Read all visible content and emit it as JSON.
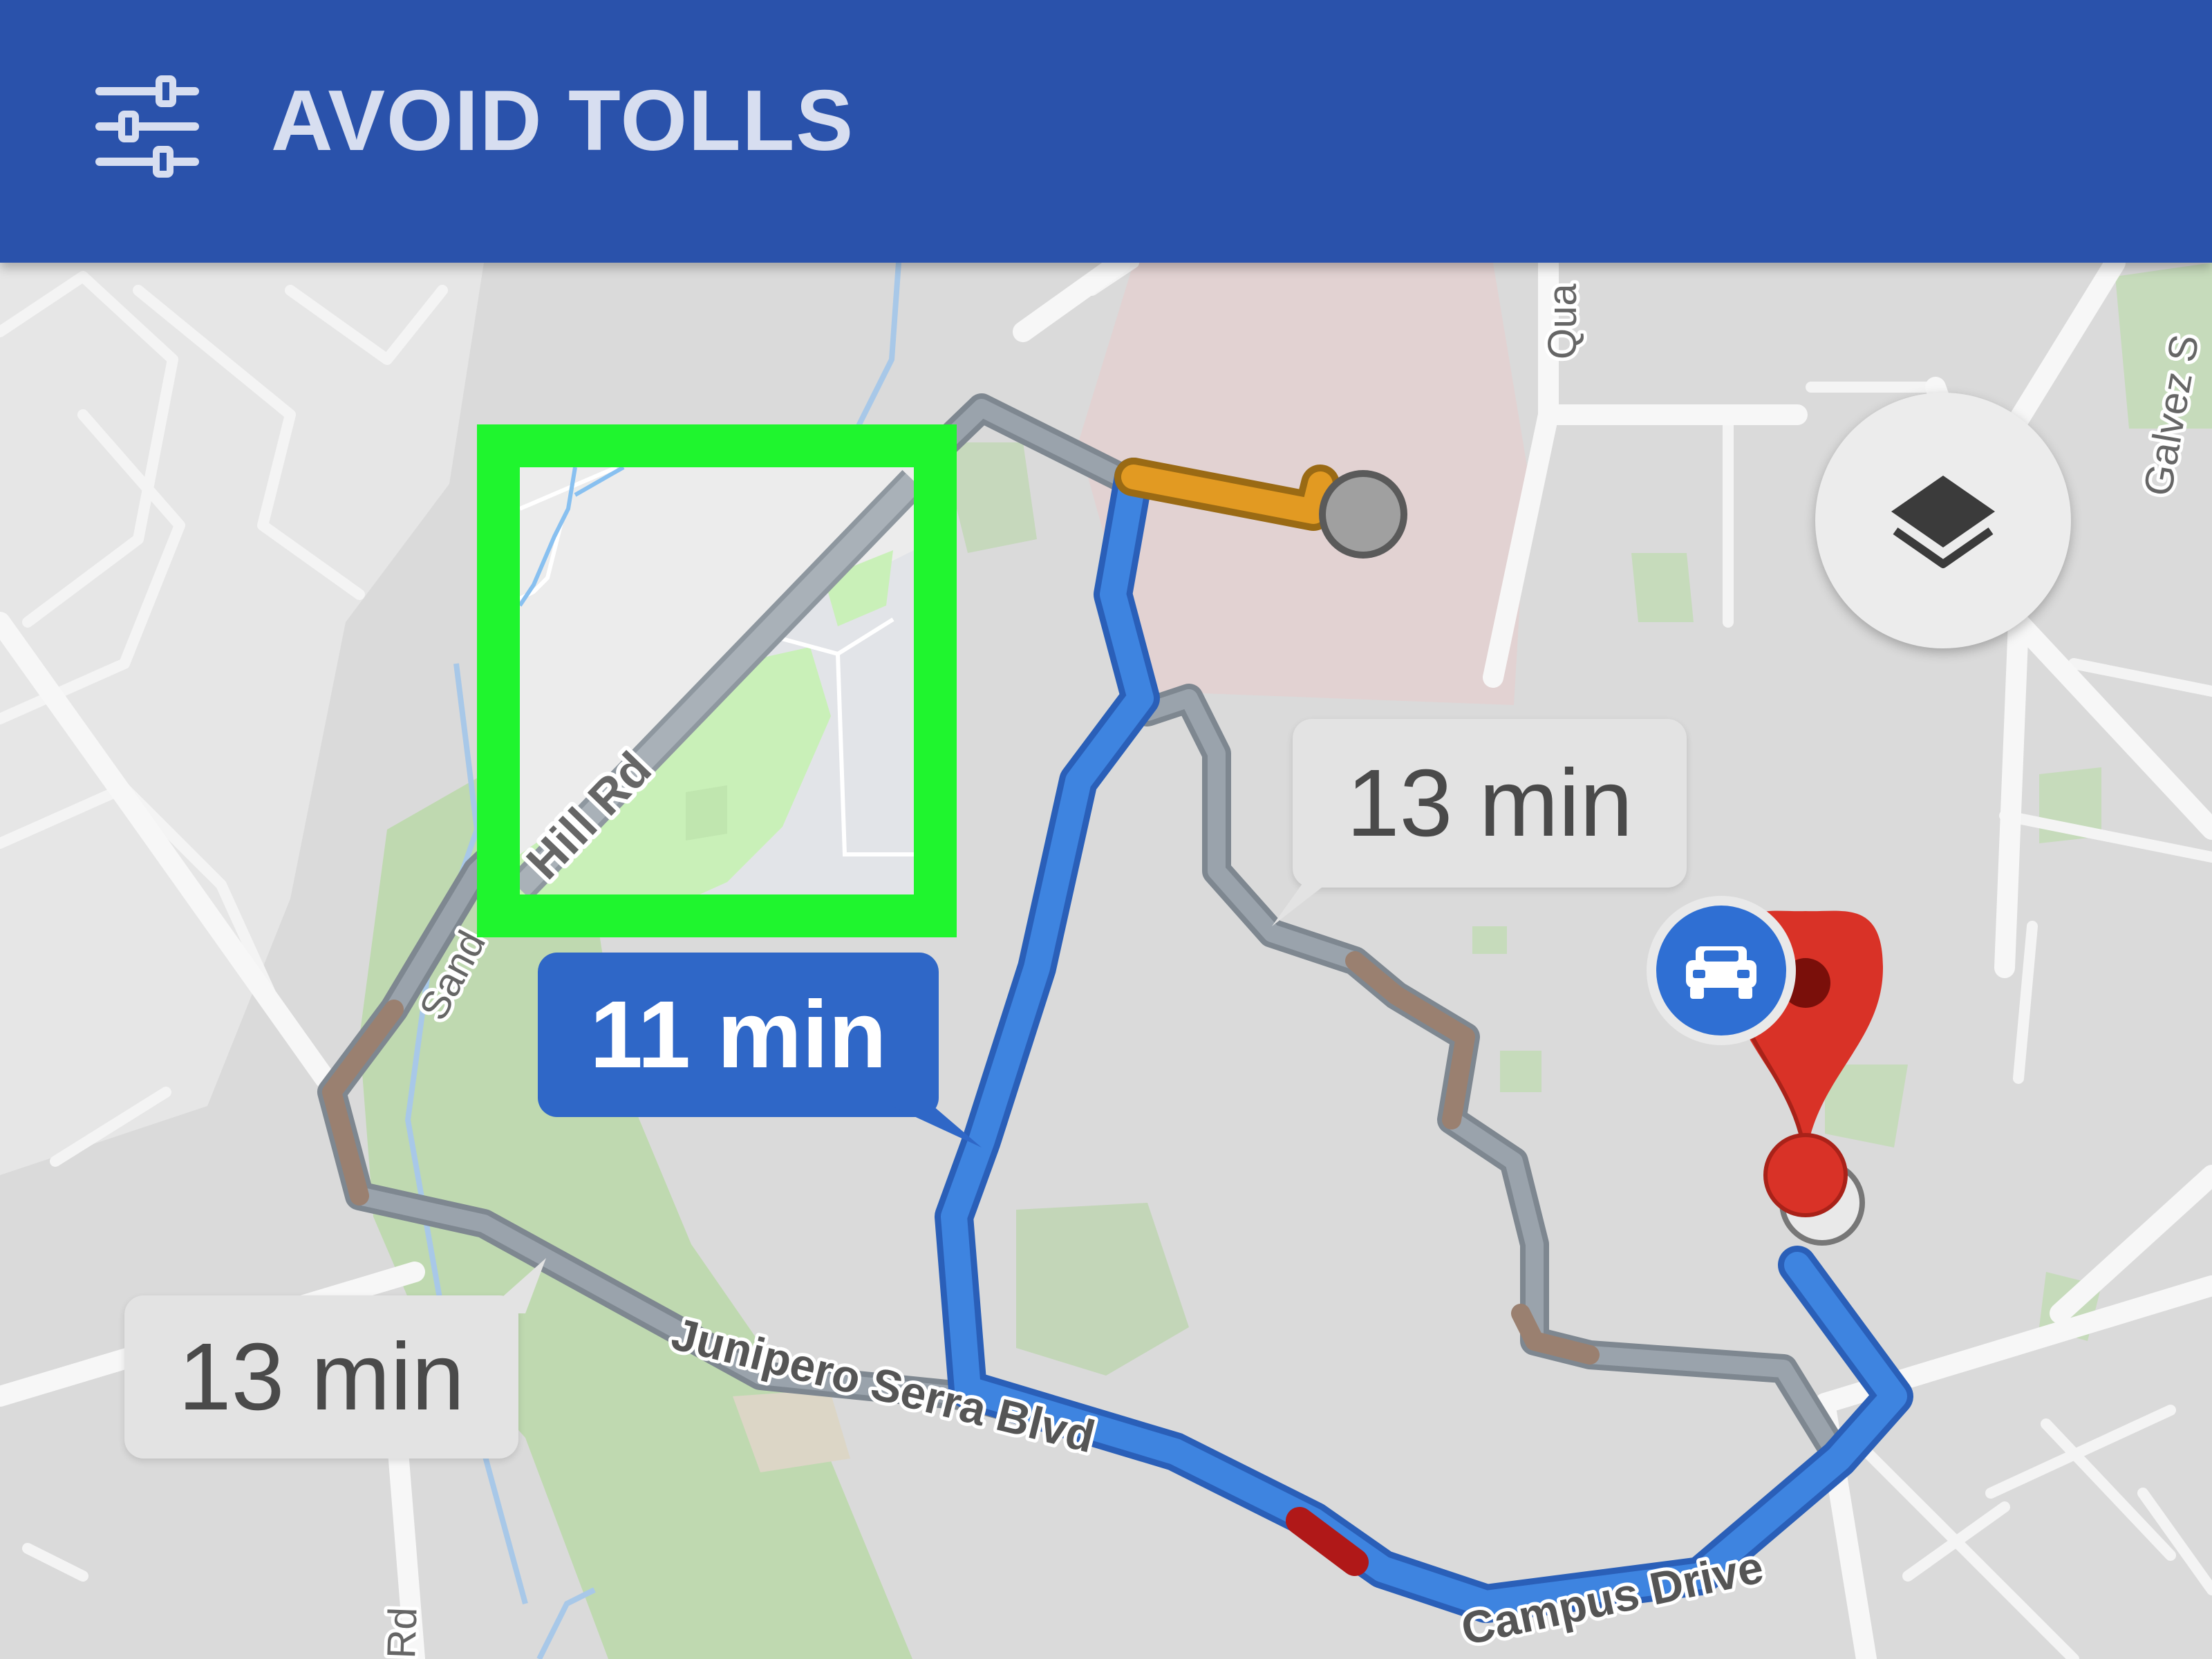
{
  "topbar": {
    "title": "AVOID TOLLS",
    "icon": "tune-sliders-icon",
    "background": "#2a52ab"
  },
  "map": {
    "street_labels": {
      "sand_hill": "Sand",
      "junipero_serra": "Junipero Serra Blvd",
      "campus_drive": "Campus Drive",
      "quarry": "Qua",
      "galvez": "Galvez S",
      "rd_bottom": "Rd"
    },
    "zoom_inset_label": "Hill Rd",
    "layers_icon": "layers-icon",
    "car_icon": "car-icon",
    "destination_icon": "destination-pin-icon",
    "origin_icon": "origin-dot-icon"
  },
  "routes": {
    "primary": {
      "time": "11 min",
      "color": "#3b7ad8"
    },
    "alternate_right": {
      "time": "13 min",
      "color": "#8c959f"
    },
    "alternate_left": {
      "time": "13 min",
      "color": "#8c959f"
    }
  },
  "highlight": {
    "color": "#1ff52e"
  }
}
